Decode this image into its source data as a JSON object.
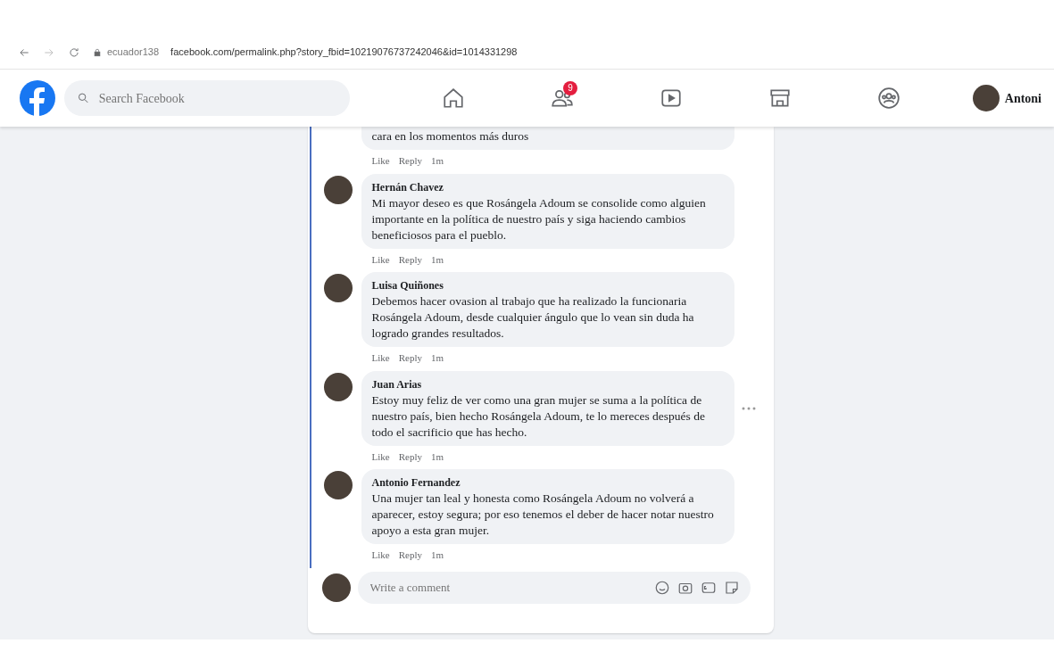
{
  "browser": {
    "site_label": "ecuador138",
    "url": "facebook.com/permalink.php?story_fbid=10219076737242046&id=1014331298"
  },
  "navbar": {
    "search_placeholder": "Search Facebook",
    "friends_badge": "9",
    "profile_name": "Antoni"
  },
  "comments": [
    {
      "text": "cara en los momentos más duros",
      "like": "Like",
      "reply": "Reply",
      "time": "1m",
      "show_more": false
    },
    {
      "name": "Hernán Chavez",
      "text": "Mi mayor deseo es que Rosángela Adoum se consolide como alguien importante en la política de nuestro país y siga haciendo cambios beneficiosos para el pueblo.",
      "like": "Like",
      "reply": "Reply",
      "time": "1m",
      "show_more": false
    },
    {
      "name": "Luisa Quiñones",
      "text": "Debemos hacer ovasion al trabajo que ha realizado la funcionaria Rosángela Adoum, desde cualquier ángulo que lo vean sin duda ha logrado grandes resultados.",
      "like": "Like",
      "reply": "Reply",
      "time": "1m",
      "show_more": false
    },
    {
      "name": "Juan Arias",
      "text": "Estoy muy feliz de ver como una gran mujer se suma a la política de nuestro país, bien hecho Rosángela Adoum, te lo mereces después de todo el sacrificio que has hecho.",
      "like": "Like",
      "reply": "Reply",
      "time": "1m",
      "show_more": true
    },
    {
      "name": "Antonio Fernandez",
      "text": "Una mujer tan leal y honesta como Rosángela Adoum no volverá a aparecer, estoy segura; por eso tenemos el deber de hacer notar nuestro apoyo a esta gran mujer.",
      "like": "Like",
      "reply": "Reply",
      "time": "1m",
      "show_more": false
    }
  ],
  "composer": {
    "placeholder": "Write a comment"
  }
}
